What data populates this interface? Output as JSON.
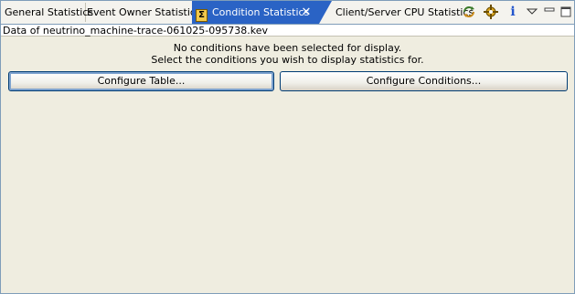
{
  "tabs": [
    {
      "label": "General Statistics",
      "active": false
    },
    {
      "label": "Event Owner Statistics",
      "active": false
    },
    {
      "label": "Condition Statistics",
      "active": true
    },
    {
      "label": "Client/Server CPU Statistics",
      "active": false
    }
  ],
  "active_tab_icon": "sigma-icon",
  "toolbar": {
    "icons": [
      "refresh-icon",
      "settings-icon",
      "info-icon",
      "view-menu-icon",
      "minimize-icon",
      "maximize-icon"
    ],
    "info_glyph": "i"
  },
  "header": {
    "data_label": "Data of neutrino_machine-trace-061025-095738.kev"
  },
  "messages": {
    "line1": "No conditions have been selected for display.",
    "line2": "Select the conditions you wish to display statistics for."
  },
  "buttons": {
    "configure_table": "Configure Table...",
    "configure_conditions": "Configure Conditions..."
  },
  "colors": {
    "active_tab": "#2a63c5",
    "background": "#efede0",
    "border": "#7f9db9"
  }
}
